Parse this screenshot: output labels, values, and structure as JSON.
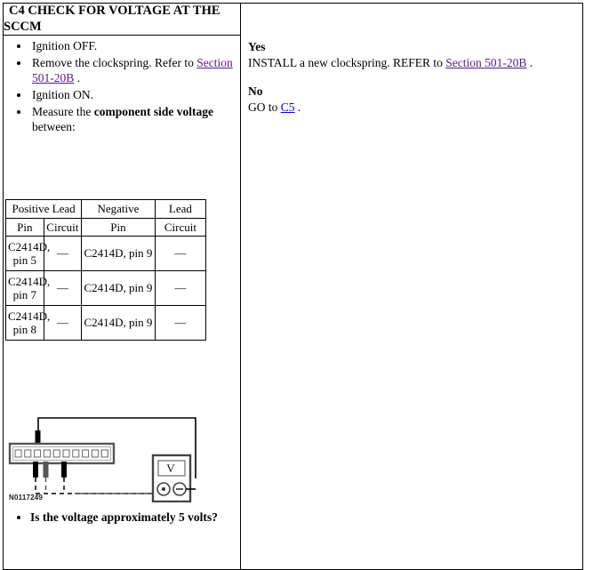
{
  "step": {
    "id": "C4",
    "header": "C4 CHECK FOR VOLTAGE AT THE SCCM"
  },
  "left": {
    "bullets": [
      {
        "text": "Ignition OFF."
      },
      {
        "text_before": "Remove the clockspring. Refer to ",
        "link": "Section 501-20B",
        "text_after": " ."
      },
      {
        "text": "Ignition ON."
      },
      {
        "text_before": "Measure the ",
        "bold": "component side voltage",
        "text_after": " between:"
      }
    ],
    "question": "Is the voltage approximately 5 volts?"
  },
  "pin_table": {
    "group_headers": [
      "Positive Lead",
      "Negative",
      "Lead"
    ],
    "sub_headers": [
      "Pin",
      "Circuit",
      "Pin",
      "Circuit"
    ],
    "rows": [
      {
        "positive_pin": "C2414D, pin 5",
        "positive_circuit": "—",
        "negative_pin": "C2414D, pin 9",
        "negative_circuit": "—"
      },
      {
        "positive_pin": "C2414D, pin 7",
        "positive_circuit": "—",
        "negative_pin": "C2414D, pin 9",
        "negative_circuit": "—"
      },
      {
        "positive_pin": "C2414D, pin 8",
        "positive_circuit": "—",
        "negative_pin": "C2414D, pin 9",
        "negative_circuit": "—"
      }
    ]
  },
  "diagram": {
    "id_label": "N0117249",
    "meter_display": "V",
    "positive_terminal": "⊙",
    "negative_terminal": "⊖",
    "connector_pin_count": 11
  },
  "right": {
    "yes": {
      "label": "Yes",
      "text_before": "INSTALL a new clockspring. REFER to ",
      "link": "Section 501-20B",
      "text_after": " ."
    },
    "no": {
      "label": "No",
      "text_before": "GO to ",
      "link": "C5",
      "text_after": " ."
    }
  },
  "colors": {
    "border": "#000000",
    "link_unvisited": "#0000EE",
    "link_visited": "#551A8B",
    "page_background": "#FFFFFF"
  }
}
